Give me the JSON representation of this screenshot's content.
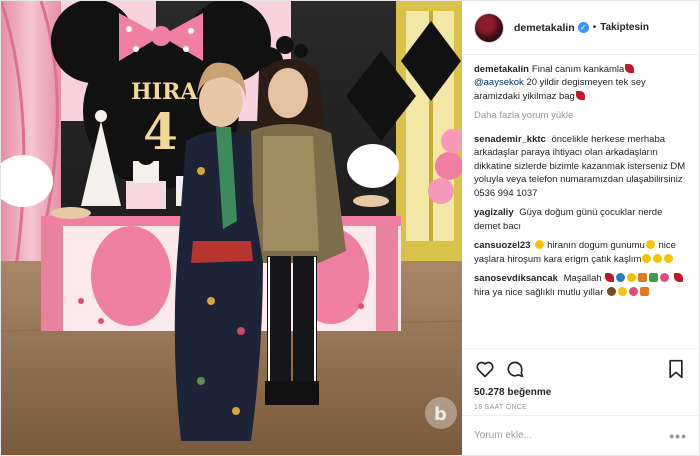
{
  "photo": {
    "banner_text": "HIRA",
    "banner_number": "4",
    "watermark": "b"
  },
  "header": {
    "username": "demetakalin",
    "verified_icon": "verified-badge-icon",
    "separator": "•",
    "follow_status": "Takiptesin"
  },
  "caption": {
    "username": "demetakalin",
    "text_1": "Final canım kankamla",
    "mention": "@aaysekok",
    "text_2": "20 yildir degismeyen tek sey aramizdaki yikilmaz bag"
  },
  "load_more": "Daha fazla yorum yükle",
  "comments": [
    {
      "username": "senademir_kktc",
      "text": "öncelikle herkese merhaba arkadaşlar paraya ihtiyacı olan arkadaşların dikkatine sizlerde bizimle kazanmak isterseniz DM yoluyla veya telefon numaramızdan ulaşabilirsiniz 0536 994 1037"
    },
    {
      "username": "yagizaliy",
      "text": "Güya doğum günü çocuklar nerde demet bacı"
    },
    {
      "username": "cansuozel23",
      "text_1": "hiranın dogum gunumu",
      "text_2": "nice yaşlara hiroşum kara erigm çatık kaşlım"
    },
    {
      "username": "sanosevdiksancak",
      "text_1": "Maşallah",
      "text_2": "hira ya nice sağlıklı mutlu yıllar"
    }
  ],
  "actions": {
    "like_icon": "heart-icon",
    "comment_icon": "comment-bubble-icon",
    "save_icon": "bookmark-icon",
    "likes": "50.278 beğenme",
    "timestamp": "16 SAAT ÖNCE"
  },
  "add_comment": {
    "placeholder": "Yorum ekle...",
    "more_icon": "more-options-icon"
  },
  "colors": {
    "accent": "#3897f0",
    "text": "#262626",
    "muted": "#999999",
    "mention": "#003569",
    "border": "#efefef"
  }
}
